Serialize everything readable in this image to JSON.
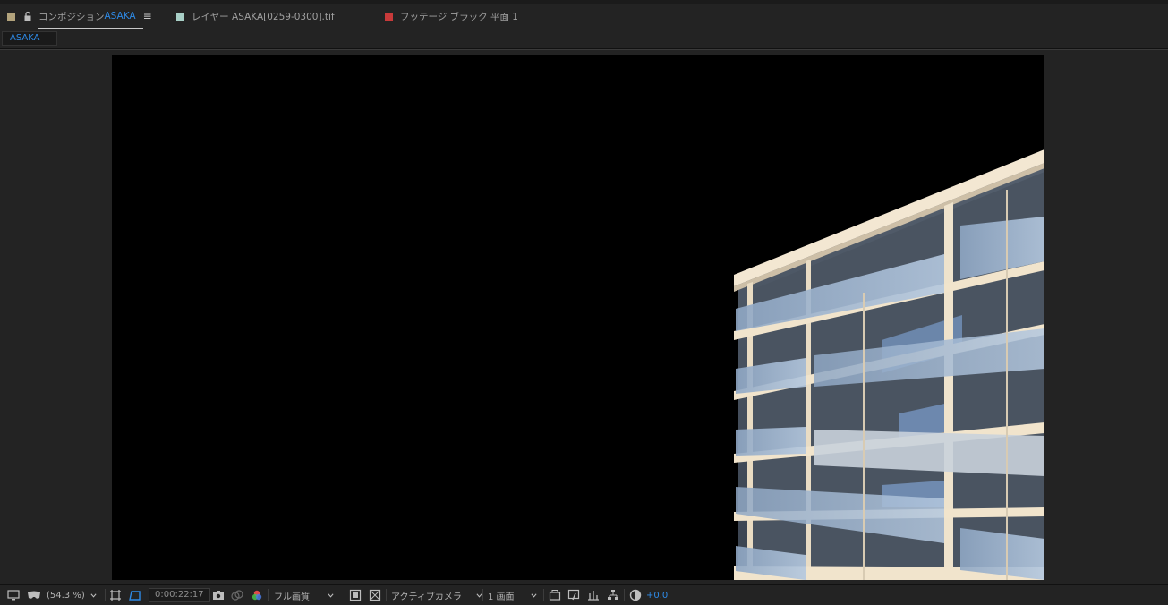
{
  "tabs": [
    {
      "prefix": "コンポジション",
      "name": "ASAKA",
      "swatch": "#b3a37c",
      "active": true
    },
    {
      "label": "レイヤー ASAKA[0259-0300].tif",
      "swatch": "#a8cfc6"
    },
    {
      "label": "フッテージ ブラック 平面 1",
      "swatch": "#c83a3a"
    }
  ],
  "menu_glyph": "≡",
  "breadcrumb": "ASAKA",
  "toolbar": {
    "zoom": "(54.3 %)",
    "timecode": "0:00:22:17",
    "resolution": "フル画質",
    "view": "アクティブカメラ",
    "layout": "1 画面",
    "exposure": "+0.0"
  },
  "colors": {
    "accent": "#2e8ae6",
    "panel": "#232323",
    "canvas": "#000000"
  },
  "icons": [
    "monitor-icon",
    "mask-icon",
    "grid-icon",
    "region-icon",
    "camera-icon",
    "color-channels-icon",
    "toggle-transparency-icon",
    "toggle-mask-icon",
    "reset-exposure-icon",
    "fast-preview-icon",
    "flowchart-icon",
    "timeline-icon"
  ]
}
